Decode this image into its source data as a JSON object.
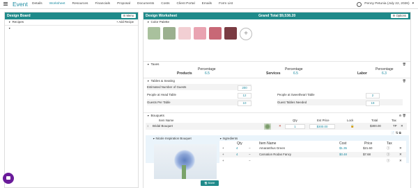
{
  "app": {
    "brand": "Event"
  },
  "nav": [
    "Details",
    "Worksheet",
    "Resources",
    "Financials",
    "Proposal",
    "Documents",
    "Costs",
    "Client Portal",
    "Emails",
    "Form List"
  ],
  "user": {
    "label": "Penny Petunia (July 22, 2026)"
  },
  "design_board": {
    "title": "Design Board",
    "menu_label": "Menu",
    "recipes_label": "Recipes",
    "add_recipe_label": "+ Add Recipe"
  },
  "worksheet": {
    "title": "Design Worksheet",
    "grand_total": "Grand Total  $9,538.20",
    "options_label": "Options",
    "color_palette_label": "Color Palette",
    "palette": [
      "#a9c19d",
      "#9bb08f",
      "#f2cfd3",
      "#e9a3b1",
      "#c86876",
      "#7a3b42"
    ],
    "taxes": {
      "label": "Taxes",
      "header": "Percentage",
      "items": [
        {
          "name": "Products",
          "value": "6.5"
        },
        {
          "name": "Services",
          "value": "6.5"
        },
        {
          "name": "Labor",
          "value": "6.3"
        }
      ]
    },
    "tables": {
      "label": "Tables & Seating",
      "estimated_label": "Estimated Number of Guests",
      "estimated_value": "200",
      "head_label": "People at Head Table",
      "head_value": "12",
      "sweetheart_label": "People at Sweetheart Table",
      "sweetheart_value": "2",
      "per_table_label": "Guests Per Table",
      "per_table_value": "10",
      "needed_label": "Guest Tables Needed",
      "needed_value": "19"
    },
    "bouquets": {
      "label": "Bouquets",
      "columns": [
        "Item Name",
        "Qty",
        "Est Price",
        "Lock",
        "Total",
        "Tax"
      ],
      "row": {
        "name": "Bridal Bouquet",
        "qty": "1",
        "est_price": "$300.00",
        "total": "$300.00",
        "tax": "TP"
      },
      "inspiration_label": "Nicole Inspiration Bouquet",
      "ingredients_label": "Ingredients",
      "ing_columns": [
        "Qty",
        "Item Name",
        "Cost",
        "Price",
        "Tax"
      ],
      "ingredients": [
        {
          "qty": "4",
          "name": "Amaranthus Green",
          "cost": "$1.35",
          "price": "$21.60"
        },
        {
          "qty": "4",
          "name": "Carnation Rodas Fancy",
          "cost": "$0.48",
          "price": "$7.68"
        },
        {
          "qty": "",
          "name": "",
          "cost": "",
          "price": ""
        }
      ]
    },
    "save_label": "Save"
  },
  "colors": {
    "teal": "#1f8a8a",
    "accent": "#1a8aa0",
    "delete_red": "#c0392b"
  }
}
